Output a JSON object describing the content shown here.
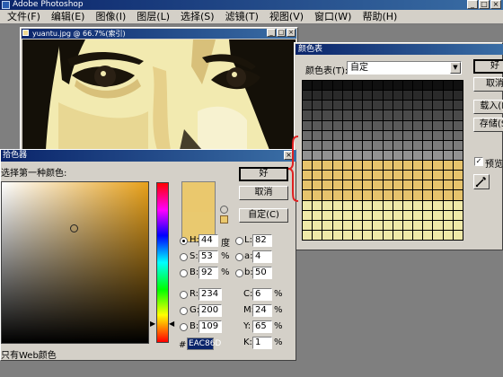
{
  "app": {
    "title": "Adobe Photoshop",
    "menu": [
      "文件(F)",
      "编辑(E)",
      "图像(I)",
      "图层(L)",
      "选择(S)",
      "滤镜(T)",
      "视图(V)",
      "窗口(W)",
      "帮助(H)"
    ],
    "win_buttons": [
      "_",
      "□",
      "×"
    ]
  },
  "image_window": {
    "title": "yuantu.jpg @ 66.7%(索引)",
    "buttons": [
      "_",
      "□",
      "×"
    ]
  },
  "palette_dialog": {
    "title": "颜色表",
    "table_label": "颜色表(T):",
    "table_value": "自定",
    "buttons": {
      "ok": "好",
      "cancel": "取消",
      "load": "载入(L)",
      "save": "存储(S)"
    },
    "preview_label": "预览(P)",
    "colors": {
      "dark_rows": [
        "#101010",
        "#2a2a2a",
        "#3a3a3a",
        "#4a4a4a",
        "#5a5a5a",
        "#6b6b6b",
        "#7c7c7c",
        "#929292"
      ],
      "mid_rows": "#e6c36c",
      "light_rows": "#efe9a8"
    }
  },
  "color_picker": {
    "title": "拾色器",
    "prompt": "选择第一种颜色:",
    "buttons": {
      "ok": "好",
      "cancel": "取消",
      "custom": "自定(C)"
    },
    "web_only_label": "只有Web颜色",
    "fields": {
      "H": {
        "label": "H:",
        "value": "44",
        "unit": "度"
      },
      "S": {
        "label": "S:",
        "value": "53",
        "unit": "%"
      },
      "B": {
        "label": "B:",
        "value": "92",
        "unit": "%"
      },
      "R": {
        "label": "R:",
        "value": "234",
        "unit": ""
      },
      "G": {
        "label": "G:",
        "value": "200",
        "unit": ""
      },
      "Bl": {
        "label": "B:",
        "value": "109",
        "unit": ""
      },
      "L": {
        "label": "L:",
        "value": "82",
        "unit": ""
      },
      "a": {
        "label": "a:",
        "value": "4",
        "unit": ""
      },
      "b": {
        "label": "b:",
        "value": "50",
        "unit": ""
      },
      "C": {
        "label": "C:",
        "value": "6",
        "unit": "%"
      },
      "M": {
        "label": "M:",
        "value": "24",
        "unit": "%"
      },
      "Y": {
        "label": "Y:",
        "value": "65",
        "unit": "%"
      },
      "K": {
        "label": "K:",
        "value": "1",
        "unit": "%"
      }
    },
    "hex_label": "#",
    "hex_value": "EAC86D",
    "current_color": "#eac86d",
    "hue_fraction_from_top": 0.88
  },
  "annotation_color": "#e02020"
}
